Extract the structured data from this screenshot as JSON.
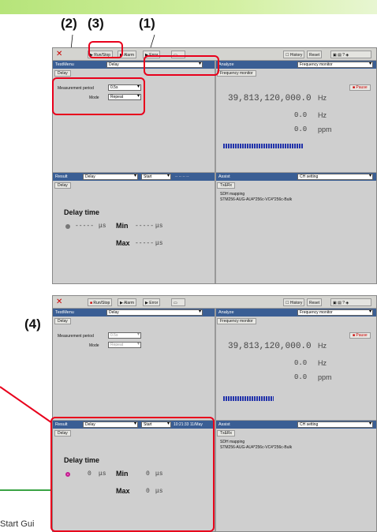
{
  "callouts": {
    "c1": "(1)",
    "c2": "(2)",
    "c3": "(3)",
    "c4": "(4)"
  },
  "footer_text": "Start Gui",
  "screens": [
    {
      "run_stop": "Run/Stop",
      "alarm": "Alarm",
      "error": "Error",
      "history": "History",
      "reset": "Reset",
      "testmenu": "TestMenu",
      "test_select": "Delay",
      "analyze": "Analyze",
      "analyze_select": "Frequency monitor",
      "delay_tab": "Delay",
      "freq_tab": "Frequency monitor",
      "meas_label": "Measurement period",
      "meas_value": "0.5s",
      "mode_label": "Mode",
      "mode_value": "Repeat",
      "freq_value": "39,813,120,000.0",
      "freq_unit": "Hz",
      "hz_value": "0.0",
      "hz_unit": "Hz",
      "ppm_value": "0.0",
      "ppm_unit": "ppm",
      "pause": "Pause",
      "result": "Result",
      "result_select": "Delay",
      "start": "Start",
      "start_time": "-- -- -- --",
      "assist": "Assist",
      "assist_select": "CH setting",
      "txrx_tab": "Tx&Rx",
      "sdh_label": "SDH mapping",
      "sdh_value": "STM256-AUG-AU4*256c-VC4*256c-Bulk",
      "delay_time": "Delay time",
      "cur": "-----",
      "cur_unit": "μs",
      "min_label": "Min",
      "min_value": "-----",
      "min_unit": "μs",
      "max_label": "Max",
      "max_value": "-----",
      "max_unit": "μs"
    },
    {
      "run_stop": "Run/Stop",
      "alarm": "Alarm",
      "error": "Error",
      "history": "History",
      "reset": "Reset",
      "testmenu": "TestMenu",
      "test_select": "Delay",
      "analyze": "Analyze",
      "analyze_select": "Frequency monitor",
      "delay_tab": "Delay",
      "freq_tab": "Frequency monitor",
      "meas_label": "Measurement period",
      "meas_value": "0.5s",
      "mode_label": "Mode",
      "mode_value": "Repeat",
      "freq_value": "39,813,120,000.0",
      "freq_unit": "Hz",
      "hz_value": "0.0",
      "hz_unit": "Hz",
      "ppm_value": "0.0",
      "ppm_unit": "ppm",
      "pause": "Pause",
      "result": "Result",
      "result_select": "Delay",
      "start": "Start",
      "start_time": "10:21:33 11/May",
      "assist": "Assist",
      "assist_select": "CH setting",
      "txrx_tab": "Tx&Rx",
      "sdh_label": "SDH mapping",
      "sdh_value": "STM256-AUG-AU4*256c-VC4*256c-Bulk",
      "delay_time": "Delay time",
      "cur": "0",
      "cur_unit": "μs",
      "min_label": "Min",
      "min_value": "0",
      "min_unit": "μs",
      "max_label": "Max",
      "max_value": "0",
      "max_unit": "μs"
    }
  ]
}
